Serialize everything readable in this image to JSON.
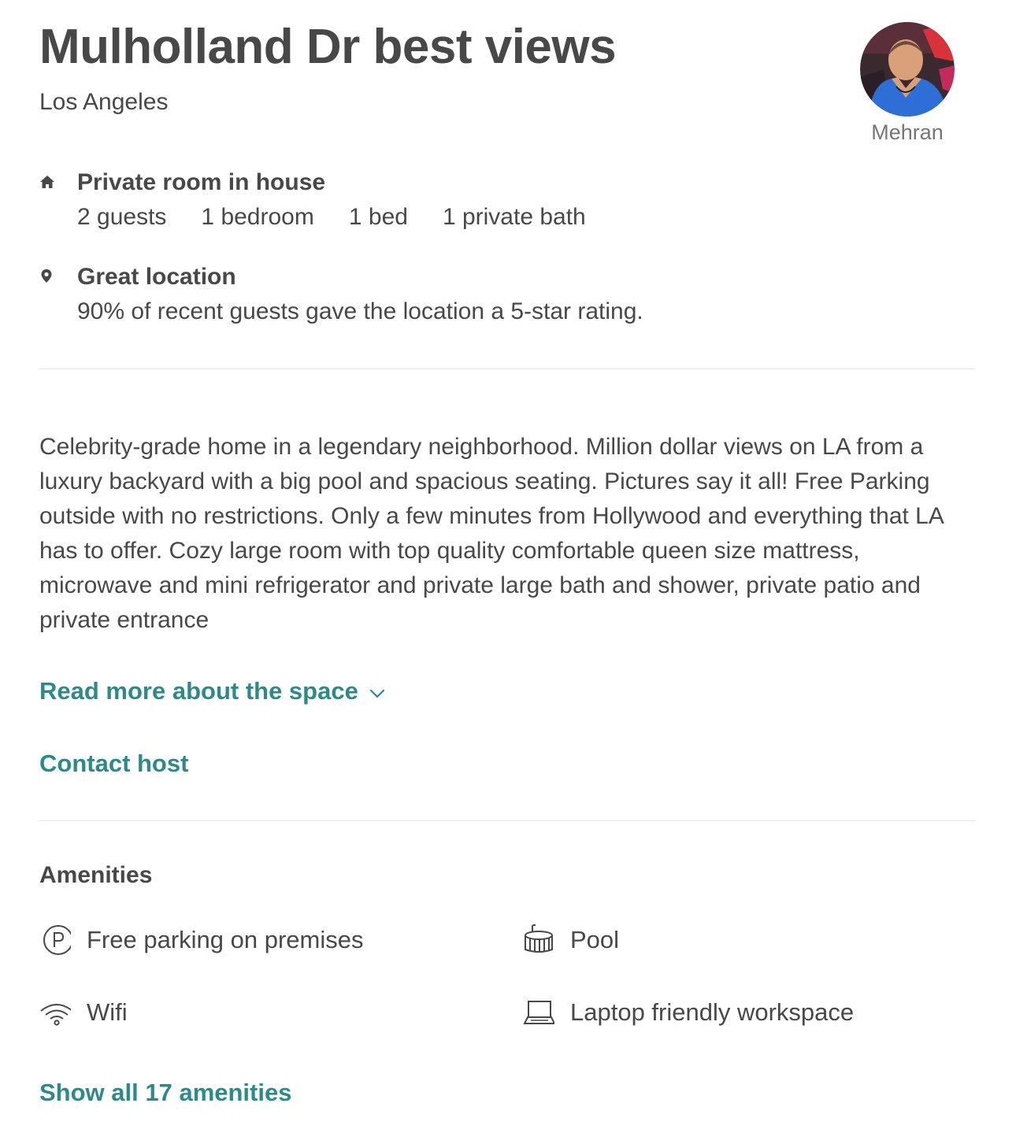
{
  "listing": {
    "title": "Mulholland Dr best views",
    "city": "Los Angeles"
  },
  "host": {
    "name": "Mehran",
    "avatar_icon": "host-avatar-photo"
  },
  "summary": {
    "room": {
      "icon": "home-icon",
      "heading": "Private room in house",
      "details": [
        "2 guests",
        "1 bedroom",
        "1 bed",
        "1 private bath"
      ]
    },
    "location": {
      "icon": "map-pin-icon",
      "heading": "Great location",
      "text": "90% of recent guests gave the location a 5-star rating."
    }
  },
  "description": {
    "text": "Celebrity-grade home in a legendary neighborhood. Million dollar views on LA from a luxury backyard with a big pool and spacious seating. Pictures say it all! Free Parking outside with no restrictions. Only a few minutes from Hollywood and everything that LA has to offer. Cozy large room with top quality comfortable queen size mattress, microwave and mini refrigerator and private large bath and shower, private patio and private entrance",
    "read_more_label": "Read more about the space",
    "contact_host_label": "Contact host"
  },
  "amenities": {
    "title": "Amenities",
    "items": [
      {
        "label": "Free parking on premises",
        "icon": "parking-icon"
      },
      {
        "label": "Pool",
        "icon": "pool-icon"
      },
      {
        "label": "Wifi",
        "icon": "wifi-icon"
      },
      {
        "label": "Laptop friendly workspace",
        "icon": "laptop-icon"
      }
    ],
    "show_all_label": "Show all 17 amenities"
  },
  "colors": {
    "text": "#484848",
    "muted": "#767676",
    "link": "#2e8a88",
    "divider": "#e4e4e4"
  }
}
